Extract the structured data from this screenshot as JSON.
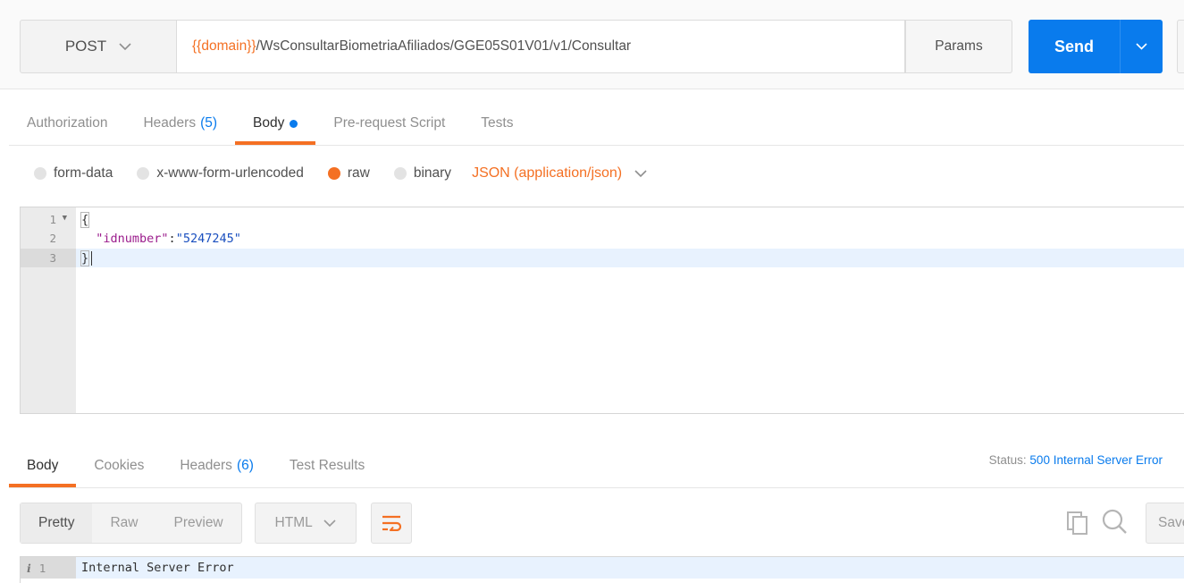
{
  "request": {
    "method": "POST",
    "url_variable": "{{domain}}",
    "url_path": "/WsConsultarBiometriaAfiliados/GGE05S01V01/v1/Consultar",
    "params_label": "Params",
    "send_label": "Send"
  },
  "request_tabs": [
    {
      "label": "Authorization",
      "count": ""
    },
    {
      "label": "Headers",
      "count": "(5)"
    },
    {
      "label": "Body",
      "count": ""
    },
    {
      "label": "Pre-request Script",
      "count": ""
    },
    {
      "label": "Tests",
      "count": ""
    }
  ],
  "active_request_tab": "Body",
  "body_types": [
    {
      "label": "form-data",
      "selected": false
    },
    {
      "label": "x-www-form-urlencoded",
      "selected": false
    },
    {
      "label": "raw",
      "selected": true
    },
    {
      "label": "binary",
      "selected": false
    }
  ],
  "content_type": "JSON (application/json)",
  "editor": {
    "lines": [
      {
        "num": "1",
        "text": "{"
      },
      {
        "num": "2",
        "indent": "  ",
        "key": "\"idnumber\"",
        "sep": ":",
        "value": "\"5247245\""
      },
      {
        "num": "3",
        "text": "}"
      }
    ],
    "current_line": 3
  },
  "response_tabs": [
    {
      "label": "Body",
      "count": ""
    },
    {
      "label": "Cookies",
      "count": ""
    },
    {
      "label": "Headers",
      "count": "(6)"
    },
    {
      "label": "Test Results",
      "count": ""
    }
  ],
  "active_response_tab": "Body",
  "status": {
    "label": "Status:",
    "value": "500 Internal Server Error"
  },
  "response_view": {
    "modes": [
      "Pretty",
      "Raw",
      "Preview"
    ],
    "active_mode": "Pretty",
    "language": "HTML",
    "save_label": "Save"
  },
  "response_body": {
    "line_num": "1",
    "text": "Internal Server Error"
  },
  "colors": {
    "accent_orange": "#f47023",
    "primary_blue": "#097bed"
  },
  "icons": [
    "chevron-down-icon",
    "wrap-lines-icon",
    "copy-icon",
    "search-icon",
    "info-icon",
    "fold-arrow-icon"
  ]
}
